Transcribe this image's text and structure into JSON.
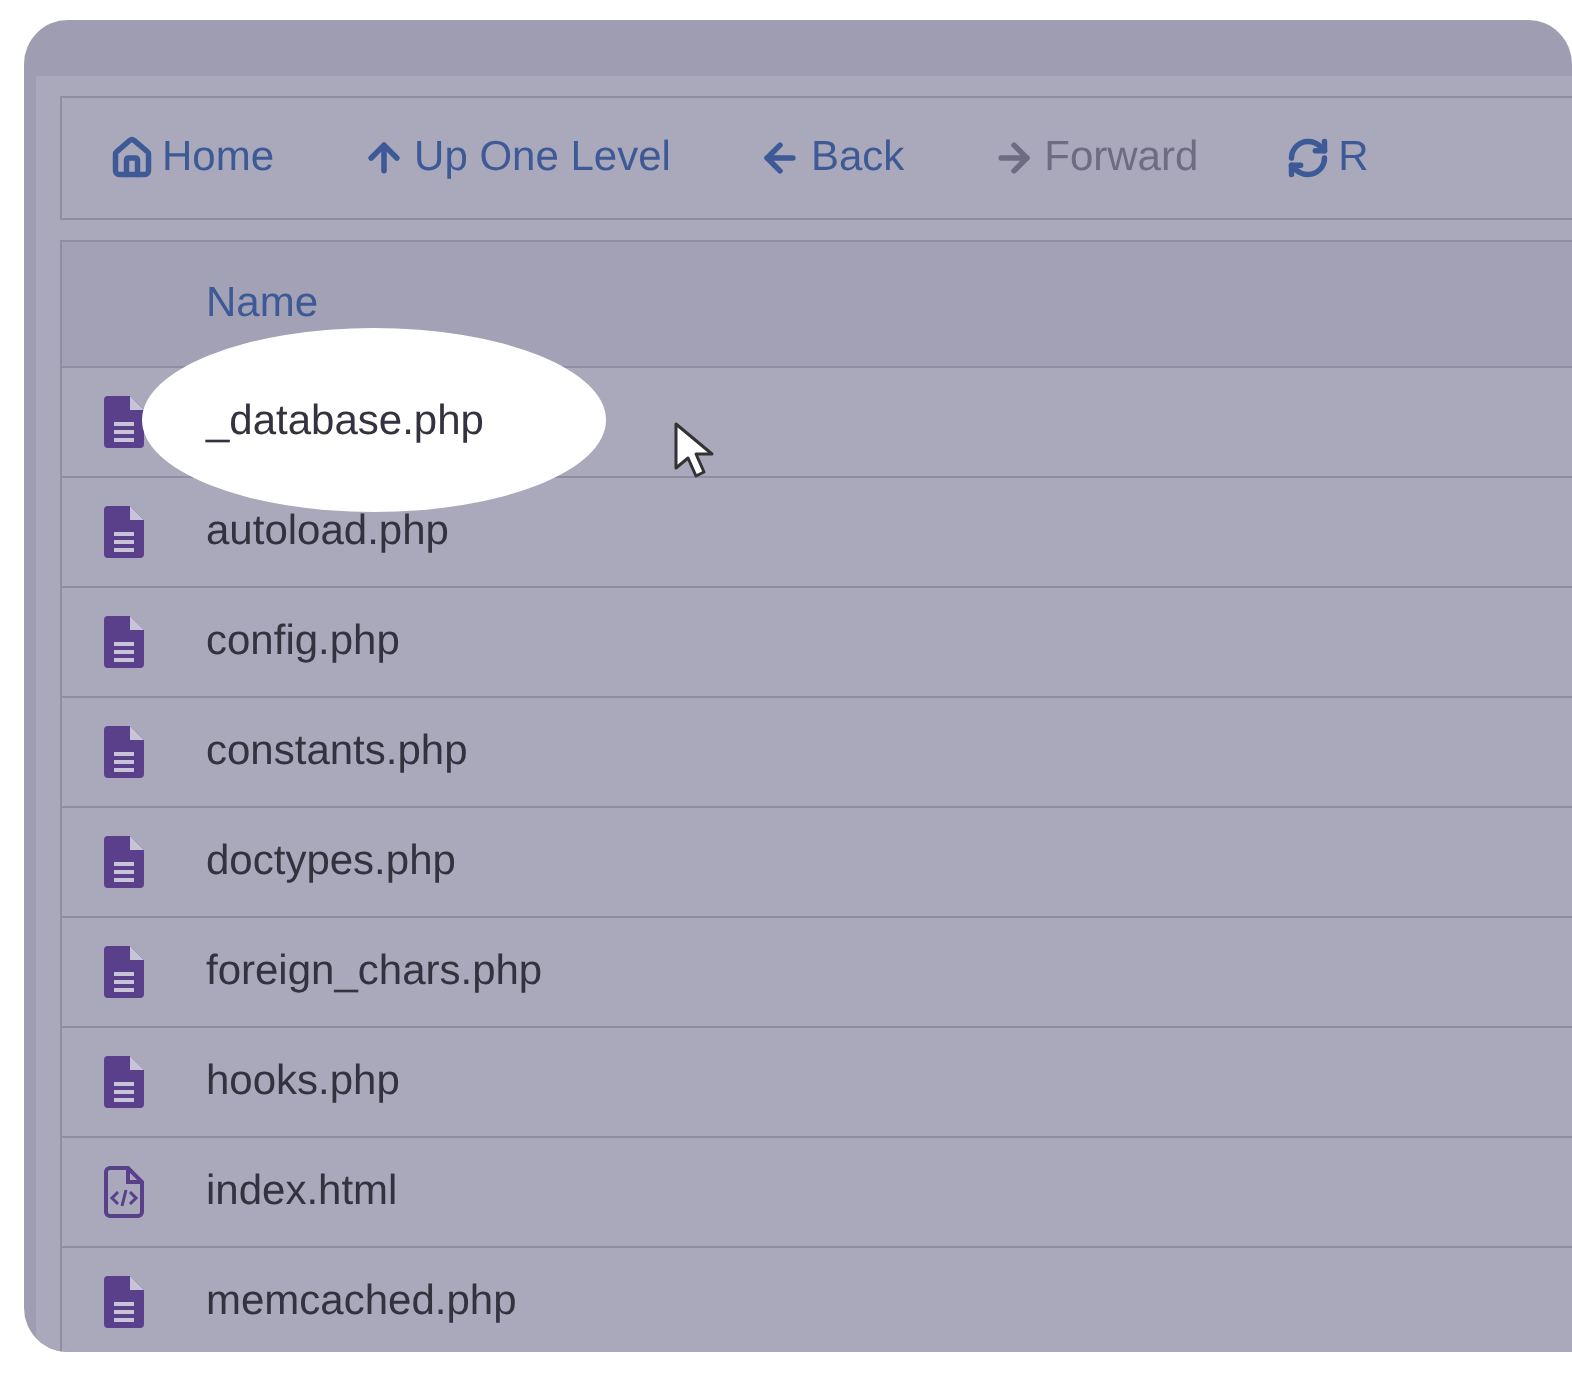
{
  "toolbar": [
    {
      "label": "Home",
      "kind": "home",
      "disabled": false
    },
    {
      "label": "Up One Level",
      "kind": "up",
      "disabled": false
    },
    {
      "label": "Back",
      "kind": "back",
      "disabled": false
    },
    {
      "label": "Forward",
      "kind": "forward",
      "disabled": true
    },
    {
      "label": "R",
      "kind": "reload",
      "disabled": false
    }
  ],
  "table": {
    "columns": [
      "Name"
    ],
    "rows": [
      {
        "name": "_database.php",
        "kind": "php",
        "highlighted": true
      },
      {
        "name": "autoload.php",
        "kind": "php",
        "highlighted": false
      },
      {
        "name": "config.php",
        "kind": "php",
        "highlighted": false
      },
      {
        "name": "constants.php",
        "kind": "php",
        "highlighted": false
      },
      {
        "name": "doctypes.php",
        "kind": "php",
        "highlighted": false
      },
      {
        "name": "foreign_chars.php",
        "kind": "php",
        "highlighted": false
      },
      {
        "name": "hooks.php",
        "kind": "php",
        "highlighted": false
      },
      {
        "name": "index.html",
        "kind": "html",
        "highlighted": false
      },
      {
        "name": "memcached.php",
        "kind": "php",
        "highlighted": false
      }
    ]
  }
}
